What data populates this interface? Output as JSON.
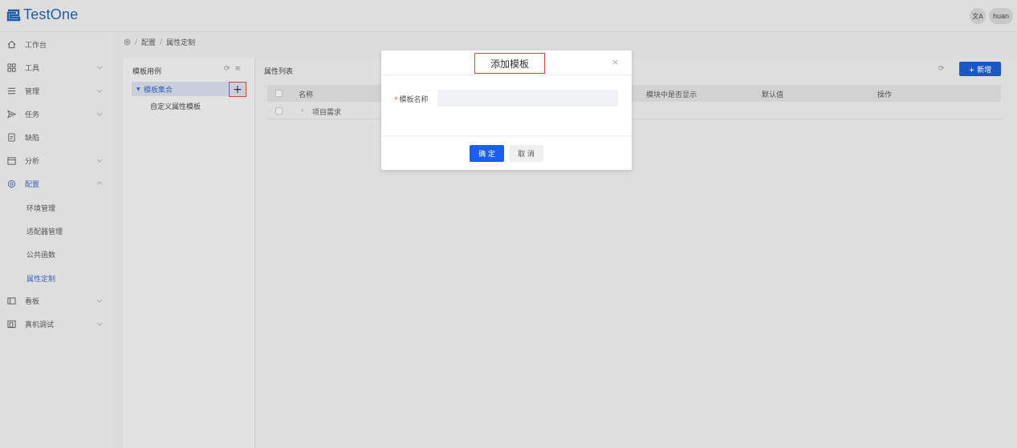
{
  "app": {
    "name": "TestOne"
  },
  "header": {
    "language_icon": "文A",
    "user": "huan"
  },
  "sidebar": {
    "items": [
      {
        "label": "工作台",
        "icon": "home-icon"
      },
      {
        "label": "工具",
        "icon": "grid-icon"
      },
      {
        "label": "管理",
        "icon": "list-icon"
      },
      {
        "label": "任务",
        "icon": "send-icon"
      },
      {
        "label": "缺陷",
        "icon": "document-icon"
      },
      {
        "label": "分析",
        "icon": "calendar-icon"
      },
      {
        "label": "配置",
        "icon": "gear-icon"
      },
      {
        "label": "看板",
        "icon": "board-icon"
      },
      {
        "label": "真机调试",
        "icon": "device-icon"
      }
    ],
    "config_children": [
      "环境管理",
      "适配器管理",
      "公共函数",
      "属性定制"
    ],
    "active_item": "配置",
    "active_child": "属性定制"
  },
  "breadcrumb": {
    "home_icon": "gear-icon",
    "level1": "配置",
    "separator": "/",
    "level2": "属性定制"
  },
  "tree_panel": {
    "title": "模板用例",
    "selected_node": "模板集合",
    "add_symbol": "+",
    "child_node": "自定义属性模板"
  },
  "list_panel": {
    "title": "属性列表",
    "add_button": "+ 新增",
    "columns": [
      "名称",
      "模块中是否显示",
      "默认值",
      "操作"
    ],
    "rows": [
      {
        "name": "项目需求"
      }
    ]
  },
  "modal": {
    "title": "添加模板",
    "close_symbol": "×",
    "field_label": "模板名称",
    "required_mark": "*",
    "field_value": "",
    "confirm_label": "确 定",
    "cancel_label": "取 消"
  }
}
